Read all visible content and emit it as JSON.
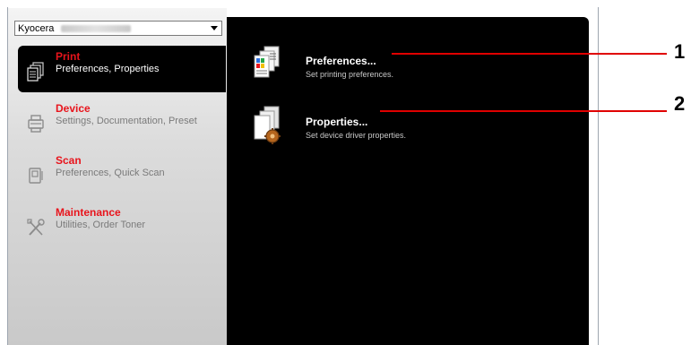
{
  "model_select": {
    "brand": "Kyocera"
  },
  "nav": [
    {
      "title": "Print",
      "subtitle": "Preferences, Properties",
      "icon": "printer-pages-icon",
      "active": true
    },
    {
      "title": "Device",
      "subtitle": "Settings, Documentation, Preset",
      "icon": "printer-device-icon",
      "active": false
    },
    {
      "title": "Scan",
      "subtitle": "Preferences, Quick Scan",
      "icon": "scanner-icon",
      "active": false
    },
    {
      "title": "Maintenance",
      "subtitle": "Utilities, Order Toner",
      "icon": "wrench-screwdriver-icon",
      "active": false
    }
  ],
  "actions": [
    {
      "title": "Preferences...",
      "description": "Set printing preferences.",
      "icon": "printing-preferences-icon"
    },
    {
      "title": "Properties...",
      "description": "Set device driver properties.",
      "icon": "driver-properties-gear-icon"
    }
  ],
  "callouts": [
    "1",
    "2"
  ],
  "colors": {
    "accent_red": "#e8141c",
    "panel_black": "#000000",
    "callout_red": "#e00000"
  }
}
